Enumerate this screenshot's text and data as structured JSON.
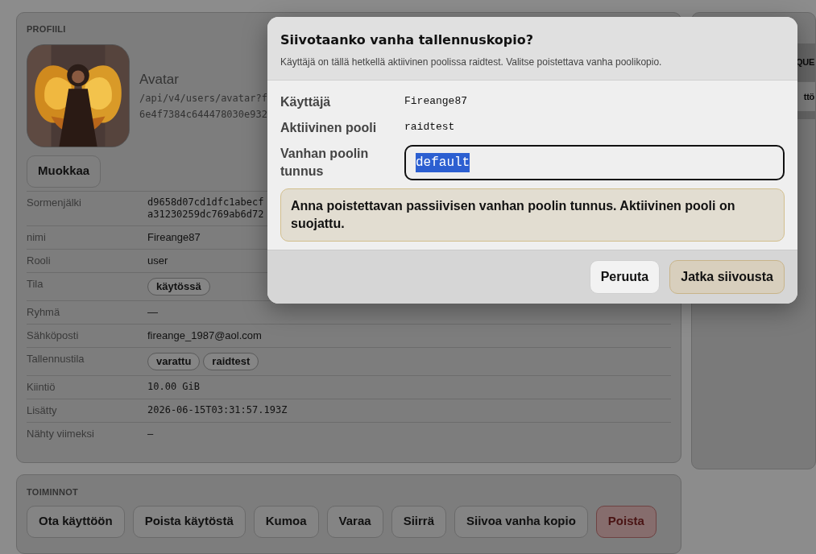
{
  "profile": {
    "heading": "PROFIILI",
    "avatar": {
      "label": "Avatar",
      "url": "/api/v4/users/avatar?f",
      "hash": "6e4f7384c644478030e932"
    },
    "edit_button": "Muokkaa",
    "fields": [
      {
        "label": "Sormenjälki",
        "kind": "mono",
        "lines": [
          "d9658d07cd1dfc1abecf",
          "a31230259dc769ab6d72"
        ]
      },
      {
        "label": "nimi",
        "kind": "text",
        "value": "Fireange87"
      },
      {
        "label": "Rooli",
        "kind": "text",
        "value": "user"
      },
      {
        "label": "Tila",
        "kind": "tags",
        "tags": [
          "käytössä"
        ]
      },
      {
        "label": "Ryhmä",
        "kind": "text",
        "value": "—"
      },
      {
        "label": "Sähköposti",
        "kind": "text",
        "value": "fireange_1987@aol.com"
      },
      {
        "label": "Tallennustila",
        "kind": "tags",
        "tags": [
          "varattu",
          "raidtest"
        ]
      },
      {
        "label": "Kiintiö",
        "kind": "mono",
        "lines": [
          "10.00 GiB"
        ]
      },
      {
        "label": "Lisätty",
        "kind": "mono",
        "lines": [
          "2026-06-15T03:31:57.193Z"
        ]
      },
      {
        "label": "Nähty viimeksi",
        "kind": "text",
        "value": "–"
      }
    ]
  },
  "side_panel": {
    "rows": [
      {
        "kind": "dark",
        "text": "QUE"
      },
      {
        "kind": "light",
        "text": "ttö"
      }
    ]
  },
  "actions": {
    "heading": "TOIMINNOT",
    "buttons": [
      {
        "label": "Ota käyttöön",
        "kind": "default"
      },
      {
        "label": "Poista käytöstä",
        "kind": "default"
      },
      {
        "label": "Kumoa",
        "kind": "default"
      },
      {
        "label": "Varaa",
        "kind": "default"
      },
      {
        "label": "Siirrä",
        "kind": "default"
      },
      {
        "label": "Siivoa vanha kopio",
        "kind": "default"
      },
      {
        "label": "Poista",
        "kind": "danger"
      }
    ]
  },
  "dialog": {
    "title": "Siivotaanko vanha tallennuskopio?",
    "description": "Käyttäjä on tällä hetkellä aktiivinen poolissa raidtest. Valitse poistettava vanha poolikopio.",
    "fields": [
      {
        "label": "Käyttäjä",
        "kind": "static",
        "value": "Fireange87"
      },
      {
        "label": "Aktiivinen pooli",
        "kind": "static",
        "value": "raidtest"
      },
      {
        "label": "Vanhan poolin tunnus",
        "kind": "input",
        "value": "default",
        "text_selected": true
      }
    ],
    "notice": "Anna poistettavan passiivisen vanhan poolin tunnus. Aktiivinen pooli on suojattu.",
    "buttons": [
      {
        "label": "Peruuta",
        "kind": "secondary"
      },
      {
        "label": "Jatka siivousta",
        "kind": "primary"
      }
    ]
  }
}
